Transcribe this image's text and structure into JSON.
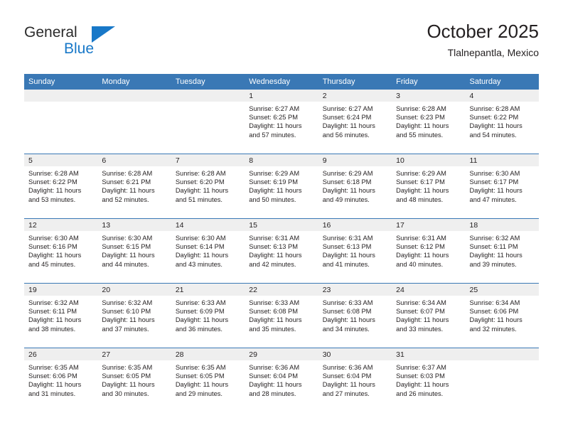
{
  "brand": {
    "name_top": "General",
    "name_bottom": "Blue",
    "triangle_icon": "triangle-icon",
    "color_blue": "#1878c8",
    "color_dark": "#2b2b2b"
  },
  "header": {
    "title": "October 2025",
    "subtitle": "Tlalnepantla, Mexico"
  },
  "theme": {
    "header_blue": "#3a78b5",
    "date_band_gray": "#efefef",
    "text": "#231f20"
  },
  "weekdays": [
    "Sunday",
    "Monday",
    "Tuesday",
    "Wednesday",
    "Thursday",
    "Friday",
    "Saturday"
  ],
  "labels": {
    "sunrise_prefix": "Sunrise:",
    "sunset_prefix": "Sunset:",
    "daylight_prefix": "Daylight:"
  },
  "weeks": [
    [
      {
        "day": "",
        "empty": true
      },
      {
        "day": "",
        "empty": true
      },
      {
        "day": "",
        "empty": true
      },
      {
        "day": "1",
        "sunrise": "Sunrise: 6:27 AM",
        "sunset": "Sunset: 6:25 PM",
        "daylight_1": "Daylight: 11 hours",
        "daylight_2": "and 57 minutes."
      },
      {
        "day": "2",
        "sunrise": "Sunrise: 6:27 AM",
        "sunset": "Sunset: 6:24 PM",
        "daylight_1": "Daylight: 11 hours",
        "daylight_2": "and 56 minutes."
      },
      {
        "day": "3",
        "sunrise": "Sunrise: 6:28 AM",
        "sunset": "Sunset: 6:23 PM",
        "daylight_1": "Daylight: 11 hours",
        "daylight_2": "and 55 minutes."
      },
      {
        "day": "4",
        "sunrise": "Sunrise: 6:28 AM",
        "sunset": "Sunset: 6:22 PM",
        "daylight_1": "Daylight: 11 hours",
        "daylight_2": "and 54 minutes."
      }
    ],
    [
      {
        "day": "5",
        "sunrise": "Sunrise: 6:28 AM",
        "sunset": "Sunset: 6:22 PM",
        "daylight_1": "Daylight: 11 hours",
        "daylight_2": "and 53 minutes."
      },
      {
        "day": "6",
        "sunrise": "Sunrise: 6:28 AM",
        "sunset": "Sunset: 6:21 PM",
        "daylight_1": "Daylight: 11 hours",
        "daylight_2": "and 52 minutes."
      },
      {
        "day": "7",
        "sunrise": "Sunrise: 6:28 AM",
        "sunset": "Sunset: 6:20 PM",
        "daylight_1": "Daylight: 11 hours",
        "daylight_2": "and 51 minutes."
      },
      {
        "day": "8",
        "sunrise": "Sunrise: 6:29 AM",
        "sunset": "Sunset: 6:19 PM",
        "daylight_1": "Daylight: 11 hours",
        "daylight_2": "and 50 minutes."
      },
      {
        "day": "9",
        "sunrise": "Sunrise: 6:29 AM",
        "sunset": "Sunset: 6:18 PM",
        "daylight_1": "Daylight: 11 hours",
        "daylight_2": "and 49 minutes."
      },
      {
        "day": "10",
        "sunrise": "Sunrise: 6:29 AM",
        "sunset": "Sunset: 6:17 PM",
        "daylight_1": "Daylight: 11 hours",
        "daylight_2": "and 48 minutes."
      },
      {
        "day": "11",
        "sunrise": "Sunrise: 6:30 AM",
        "sunset": "Sunset: 6:17 PM",
        "daylight_1": "Daylight: 11 hours",
        "daylight_2": "and 47 minutes."
      }
    ],
    [
      {
        "day": "12",
        "sunrise": "Sunrise: 6:30 AM",
        "sunset": "Sunset: 6:16 PM",
        "daylight_1": "Daylight: 11 hours",
        "daylight_2": "and 45 minutes."
      },
      {
        "day": "13",
        "sunrise": "Sunrise: 6:30 AM",
        "sunset": "Sunset: 6:15 PM",
        "daylight_1": "Daylight: 11 hours",
        "daylight_2": "and 44 minutes."
      },
      {
        "day": "14",
        "sunrise": "Sunrise: 6:30 AM",
        "sunset": "Sunset: 6:14 PM",
        "daylight_1": "Daylight: 11 hours",
        "daylight_2": "and 43 minutes."
      },
      {
        "day": "15",
        "sunrise": "Sunrise: 6:31 AM",
        "sunset": "Sunset: 6:13 PM",
        "daylight_1": "Daylight: 11 hours",
        "daylight_2": "and 42 minutes."
      },
      {
        "day": "16",
        "sunrise": "Sunrise: 6:31 AM",
        "sunset": "Sunset: 6:13 PM",
        "daylight_1": "Daylight: 11 hours",
        "daylight_2": "and 41 minutes."
      },
      {
        "day": "17",
        "sunrise": "Sunrise: 6:31 AM",
        "sunset": "Sunset: 6:12 PM",
        "daylight_1": "Daylight: 11 hours",
        "daylight_2": "and 40 minutes."
      },
      {
        "day": "18",
        "sunrise": "Sunrise: 6:32 AM",
        "sunset": "Sunset: 6:11 PM",
        "daylight_1": "Daylight: 11 hours",
        "daylight_2": "and 39 minutes."
      }
    ],
    [
      {
        "day": "19",
        "sunrise": "Sunrise: 6:32 AM",
        "sunset": "Sunset: 6:11 PM",
        "daylight_1": "Daylight: 11 hours",
        "daylight_2": "and 38 minutes."
      },
      {
        "day": "20",
        "sunrise": "Sunrise: 6:32 AM",
        "sunset": "Sunset: 6:10 PM",
        "daylight_1": "Daylight: 11 hours",
        "daylight_2": "and 37 minutes."
      },
      {
        "day": "21",
        "sunrise": "Sunrise: 6:33 AM",
        "sunset": "Sunset: 6:09 PM",
        "daylight_1": "Daylight: 11 hours",
        "daylight_2": "and 36 minutes."
      },
      {
        "day": "22",
        "sunrise": "Sunrise: 6:33 AM",
        "sunset": "Sunset: 6:08 PM",
        "daylight_1": "Daylight: 11 hours",
        "daylight_2": "and 35 minutes."
      },
      {
        "day": "23",
        "sunrise": "Sunrise: 6:33 AM",
        "sunset": "Sunset: 6:08 PM",
        "daylight_1": "Daylight: 11 hours",
        "daylight_2": "and 34 minutes."
      },
      {
        "day": "24",
        "sunrise": "Sunrise: 6:34 AM",
        "sunset": "Sunset: 6:07 PM",
        "daylight_1": "Daylight: 11 hours",
        "daylight_2": "and 33 minutes."
      },
      {
        "day": "25",
        "sunrise": "Sunrise: 6:34 AM",
        "sunset": "Sunset: 6:06 PM",
        "daylight_1": "Daylight: 11 hours",
        "daylight_2": "and 32 minutes."
      }
    ],
    [
      {
        "day": "26",
        "sunrise": "Sunrise: 6:35 AM",
        "sunset": "Sunset: 6:06 PM",
        "daylight_1": "Daylight: 11 hours",
        "daylight_2": "and 31 minutes."
      },
      {
        "day": "27",
        "sunrise": "Sunrise: 6:35 AM",
        "sunset": "Sunset: 6:05 PM",
        "daylight_1": "Daylight: 11 hours",
        "daylight_2": "and 30 minutes."
      },
      {
        "day": "28",
        "sunrise": "Sunrise: 6:35 AM",
        "sunset": "Sunset: 6:05 PM",
        "daylight_1": "Daylight: 11 hours",
        "daylight_2": "and 29 minutes."
      },
      {
        "day": "29",
        "sunrise": "Sunrise: 6:36 AM",
        "sunset": "Sunset: 6:04 PM",
        "daylight_1": "Daylight: 11 hours",
        "daylight_2": "and 28 minutes."
      },
      {
        "day": "30",
        "sunrise": "Sunrise: 6:36 AM",
        "sunset": "Sunset: 6:04 PM",
        "daylight_1": "Daylight: 11 hours",
        "daylight_2": "and 27 minutes."
      },
      {
        "day": "31",
        "sunrise": "Sunrise: 6:37 AM",
        "sunset": "Sunset: 6:03 PM",
        "daylight_1": "Daylight: 11 hours",
        "daylight_2": "and 26 minutes."
      },
      {
        "day": "",
        "empty": true
      }
    ]
  ]
}
